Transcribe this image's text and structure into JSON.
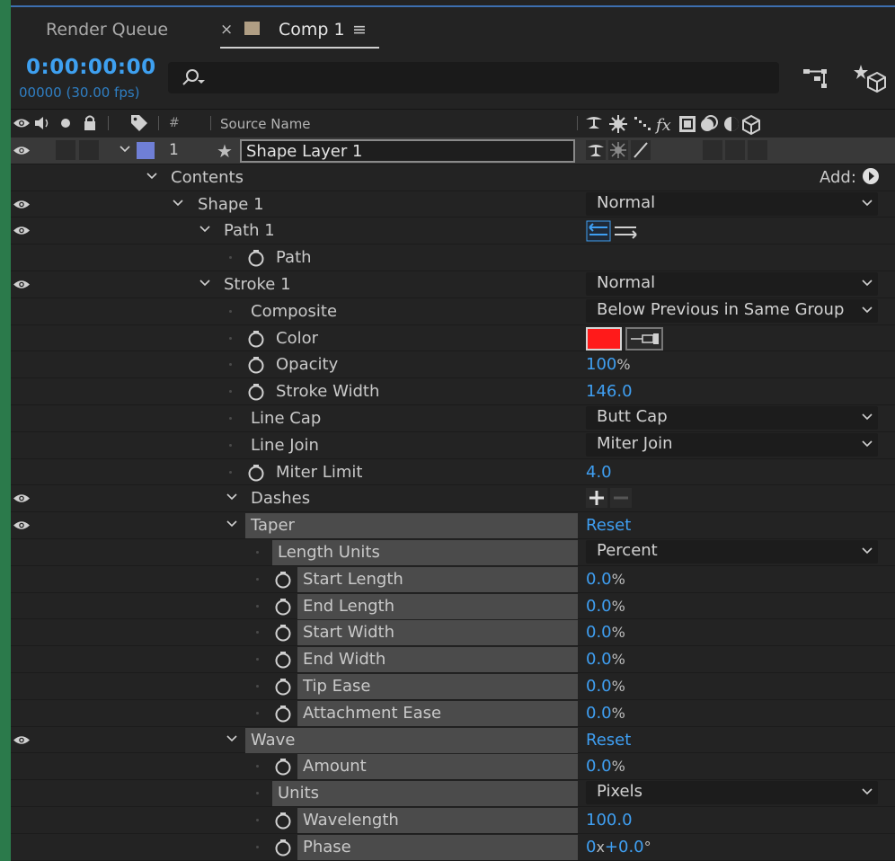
{
  "tabs": {
    "render_queue": "Render Queue",
    "close": "×",
    "comp": "Comp 1",
    "menu": "≡"
  },
  "timecode": {
    "time": "0:00:00:00",
    "frames": "00000 (30.00 fps)"
  },
  "search": {
    "placeholder": ""
  },
  "columns": {
    "hash": "#",
    "source_name": "Source Name"
  },
  "layer": {
    "number": "1",
    "name": "Shape Layer 1",
    "label_color": "#6f7fd6"
  },
  "contents": {
    "label": "Contents",
    "add_label": "Add:"
  },
  "properties": {
    "shape1": {
      "label": "Shape 1",
      "blend": "Normal"
    },
    "path1": {
      "label": "Path 1"
    },
    "path": {
      "label": "Path"
    },
    "stroke1": {
      "label": "Stroke 1",
      "blend": "Normal"
    },
    "composite": {
      "label": "Composite",
      "value": "Below Previous in Same Group"
    },
    "color": {
      "label": "Color",
      "value": "#ff1a1a"
    },
    "opacity": {
      "label": "Opacity",
      "value": "100",
      "unit": "%"
    },
    "stroke_width": {
      "label": "Stroke Width",
      "value": "146.0"
    },
    "line_cap": {
      "label": "Line Cap",
      "value": "Butt Cap"
    },
    "line_join": {
      "label": "Line Join",
      "value": "Miter Join"
    },
    "miter_limit": {
      "label": "Miter Limit",
      "value": "4.0"
    },
    "dashes": {
      "label": "Dashes"
    },
    "taper": {
      "label": "Taper",
      "reset": "Reset"
    },
    "length_units": {
      "label": "Length Units",
      "value": "Percent"
    },
    "start_length": {
      "label": "Start Length",
      "value": "0.0",
      "unit": "%"
    },
    "end_length": {
      "label": "End Length",
      "value": "0.0",
      "unit": "%"
    },
    "start_width": {
      "label": "Start Width",
      "value": "0.0",
      "unit": "%"
    },
    "end_width": {
      "label": "End Width",
      "value": "0.0",
      "unit": "%"
    },
    "tip_ease": {
      "label": "Tip Ease",
      "value": "0.0",
      "unit": "%"
    },
    "attachment_ease": {
      "label": "Attachment Ease",
      "value": "0.0",
      "unit": "%"
    },
    "wave": {
      "label": "Wave",
      "reset": "Reset"
    },
    "amount": {
      "label": "Amount",
      "value": "0.0",
      "unit": "%"
    },
    "units": {
      "label": "Units",
      "value": "Pixels"
    },
    "wavelength": {
      "label": "Wavelength",
      "value": "100.0"
    },
    "phase": {
      "label": "Phase",
      "rev": "0",
      "x": "x",
      "deg": "+0.0",
      "deg_unit": "°"
    }
  }
}
